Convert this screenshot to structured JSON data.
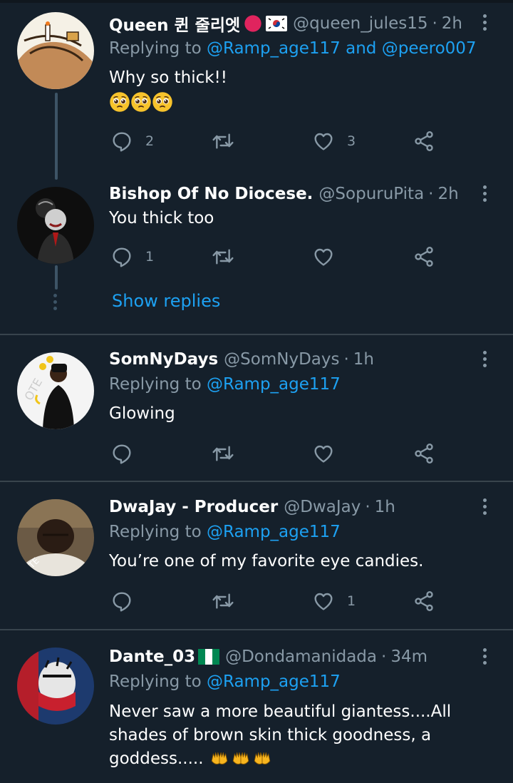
{
  "tweets": [
    {
      "name": "Queen 퀸 줄리엣",
      "handle": "@queen_jules15",
      "time": "2h",
      "replying_prefix": "Replying to",
      "mention1": "@Ramp_age117",
      "and": "and",
      "mention2": "@peero007",
      "text": "Why so thick!!",
      "replies": "2",
      "retweets": "",
      "likes": "3"
    },
    {
      "name": "Bishop Of No Diocese.",
      "handle": "@SopuruPita",
      "time": "2h",
      "text": "You thick too",
      "replies": "1",
      "retweets": "",
      "likes": ""
    },
    {
      "name": "SomNyDays",
      "handle": "@SomNyDays",
      "time": "1h",
      "replying_prefix": "Replying to",
      "mention1": "@Ramp_age117",
      "text": "Glowing",
      "replies": "",
      "retweets": "",
      "likes": ""
    },
    {
      "name": "DwaJay - Producer",
      "handle": "@DwaJay",
      "time": "1h",
      "replying_prefix": "Replying to",
      "mention1": "@Ramp_age117",
      "text": "You’re one of my favorite eye candies.",
      "replies": "",
      "retweets": "",
      "likes": "1"
    },
    {
      "name": "Dante_03",
      "handle": "@Dondamanidada",
      "time": "34m",
      "replying_prefix": "Replying to",
      "mention1": "@Ramp_age117",
      "text_line1": "Never saw a more beautiful giantess....All",
      "text_line2": "shades of brown skin thick goodness, a",
      "text_line3": "goddess.....",
      "replies": "",
      "retweets": "",
      "likes": ""
    }
  ],
  "show_replies": "Show replies",
  "separator": "·",
  "colors": {
    "background": "#15202b",
    "secondary_text": "#8899a6",
    "accent": "#1da1f2",
    "divider": "#38444d"
  }
}
